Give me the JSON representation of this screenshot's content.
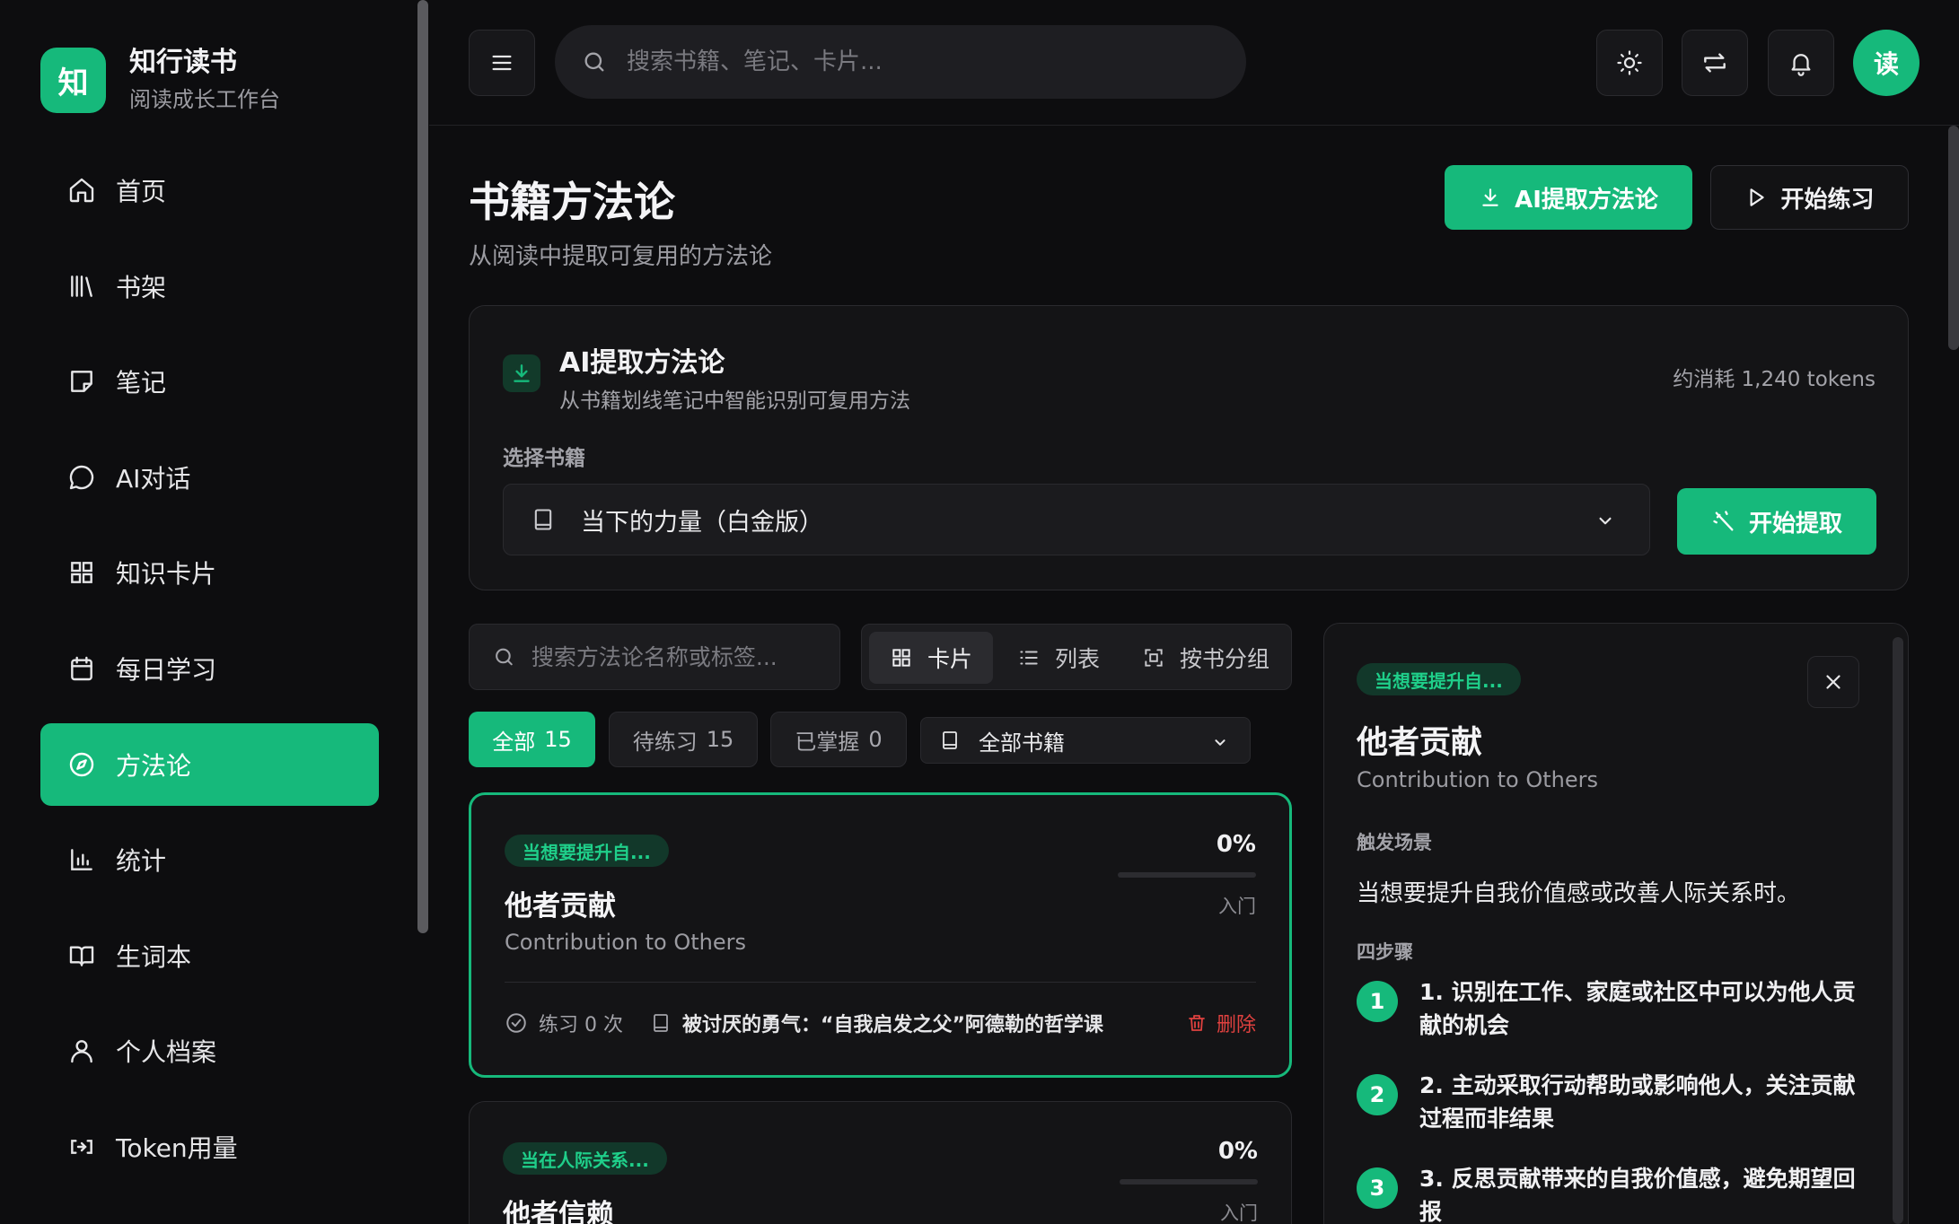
{
  "brand": {
    "logo": "知",
    "title": "知行读书",
    "subtitle": "阅读成长工作台"
  },
  "nav": [
    {
      "label": "首页",
      "icon": "home-icon"
    },
    {
      "label": "书架",
      "icon": "library-icon"
    },
    {
      "label": "笔记",
      "icon": "note-icon"
    },
    {
      "label": "AI对话",
      "icon": "chat-icon"
    },
    {
      "label": "知识卡片",
      "icon": "grid-icon"
    },
    {
      "label": "每日学习",
      "icon": "calendar-icon"
    },
    {
      "label": "方法论",
      "icon": "compass-icon",
      "active": true
    },
    {
      "label": "统计",
      "icon": "chart-icon"
    },
    {
      "label": "生词本",
      "icon": "book-open-icon"
    },
    {
      "label": "个人档案",
      "icon": "user-icon"
    },
    {
      "label": "Token用量",
      "icon": "coins-icon"
    }
  ],
  "topbar": {
    "search_placeholder": "搜索书籍、笔记、卡片...",
    "avatar": "读"
  },
  "page": {
    "title": "书籍方法论",
    "subtitle": "从阅读中提取可复用的方法论",
    "ai_extract_button": "AI提取方法论",
    "practice_button": "开始练习"
  },
  "extract_panel": {
    "title": "AI提取方法论",
    "subtitle": "从书籍划线笔记中智能识别可复用方法",
    "tokens": "约消耗 1,240 tokens",
    "select_label": "选择书籍",
    "selected_book": "当下的力量（白金版）",
    "start_button": "开始提取"
  },
  "toolbar": {
    "search_placeholder": "搜索方法论名称或标签...",
    "views": [
      {
        "label": "卡片",
        "icon": "grid-icon",
        "active": true
      },
      {
        "label": "列表",
        "icon": "list-icon"
      },
      {
        "label": "按书分组",
        "icon": "group-icon"
      }
    ]
  },
  "filters": [
    {
      "label": "全部",
      "count": "15",
      "active": true
    },
    {
      "label": "待练习",
      "count": "15"
    },
    {
      "label": "已掌握",
      "count": "0"
    }
  ],
  "book_filter": "全部书籍",
  "cards": [
    {
      "tag": "当想要提升自...",
      "title": "他者贡献",
      "en": "Contribution to Others",
      "percent": "0%",
      "progress": 0,
      "level": "入门",
      "practice": "练习 0 次",
      "book": "被讨厌的勇气：“自我启发之父”阿德勒的哲学课",
      "delete": "删除"
    },
    {
      "tag": "当在人际关系...",
      "title": "他者信赖",
      "percent": "0%",
      "progress": 0,
      "level": "入门"
    }
  ],
  "detail": {
    "tag": "当想要提升自...",
    "title": "他者贡献",
    "en": "Contribution to Others",
    "trigger_label": "触发场景",
    "trigger": "当想要提升自我价值感或改善人际关系时。",
    "steps_label": "四步骤",
    "steps": [
      {
        "num": "1",
        "text": "1. 识别在工作、家庭或社区中可以为他人贡献的机会"
      },
      {
        "num": "2",
        "text": "2. 主动采取行动帮助或影响他人，关注贡献过程而非结果"
      },
      {
        "num": "3",
        "text": "3. 反思贡献带来的自我价值感，避免期望回报"
      }
    ]
  },
  "colors": {
    "accent": "#16b97b",
    "danger": "#e0413f",
    "background": "#0d0d0f"
  }
}
